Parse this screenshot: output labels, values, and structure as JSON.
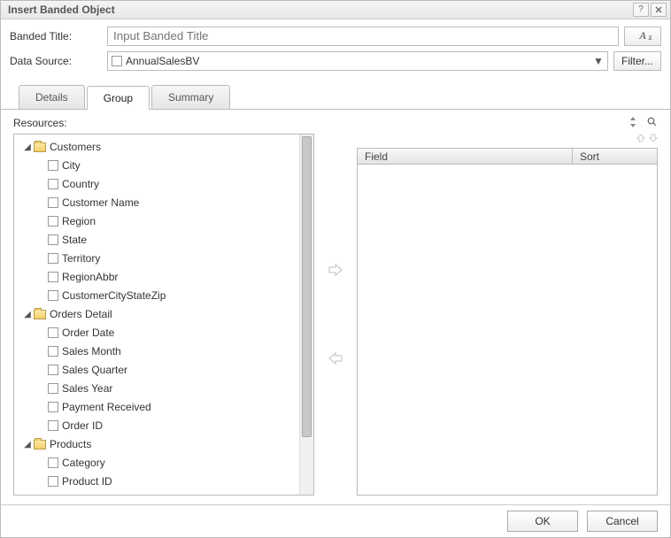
{
  "dialog": {
    "title": "Insert Banded Object"
  },
  "form": {
    "banded_title_label": "Banded Title:",
    "banded_title_placeholder": "Input Banded Title",
    "font_btn": "A",
    "data_source_label": "Data Source:",
    "data_source_value": "AnnualSalesBV",
    "filter_btn": "Filter..."
  },
  "tabs": {
    "details": "Details",
    "group": "Group",
    "summary": "Summary",
    "active": "group"
  },
  "resources": {
    "label": "Resources:",
    "tree": [
      {
        "label": "Customers",
        "children": [
          "City",
          "Country",
          "Customer Name",
          "Region",
          "State",
          "Territory",
          "RegionAbbr",
          "CustomerCityStateZip"
        ]
      },
      {
        "label": "Orders Detail",
        "children": [
          "Order Date",
          "Sales Month",
          "Sales Quarter",
          "Sales Year",
          "Payment Received",
          "Order ID"
        ]
      },
      {
        "label": "Products",
        "children": [
          "Category",
          "Product ID"
        ]
      }
    ]
  },
  "table": {
    "field_header": "Field",
    "sort_header": "Sort"
  },
  "footer": {
    "ok": "OK",
    "cancel": "Cancel"
  }
}
